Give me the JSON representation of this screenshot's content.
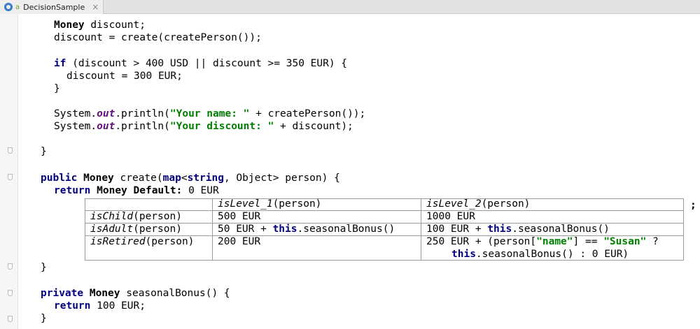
{
  "tab": {
    "title": "DecisionSample",
    "close": "×",
    "glyph": "a"
  },
  "code": {
    "l1_type": "Money",
    "l1_rest": " discount;",
    "l2": "discount = create(createPerson());",
    "l3_kw": "if",
    "l3_rest": " (discount > 400 USD || discount >= 350 EUR) {",
    "l4": "discount = 300 EUR;",
    "l5": "}",
    "l6_a": "System.",
    "l6_fld": "out",
    "l6_b": ".println(",
    "l6_str": "\"Your name: \"",
    "l6_c": " + createPerson());",
    "l7_a": "System.",
    "l7_fld": "out",
    "l7_b": ".println(",
    "l7_str": "\"Your discount: \"",
    "l7_c": " + discount);",
    "l8": "}",
    "l9_kw": "public",
    "l9_type": "Money",
    "l9_a": " create(",
    "l9_map": "map",
    "l9_b": "<",
    "l9_string": "string",
    "l9_c": ", Object> person) {",
    "l10_kw": "return",
    "l10_type": "Money Default:",
    "l10_rest": " 0 EUR",
    "semicolon": ";",
    "l11": "}",
    "l12_kw": "private",
    "l12_type": "Money",
    "l12_rest": " seasonalBonus() {",
    "l13_kw": "return",
    "l13_rest": " 100 EUR;",
    "l14": "}"
  },
  "table": {
    "col1_fn": "isLevel_1",
    "col1_arg": "(person)",
    "col2_fn": "isLevel_2",
    "col2_arg": "(person)",
    "rows": [
      {
        "cond_fn": "isChild",
        "cond_arg": "(person)",
        "c1": "500 EUR",
        "c2": "1000 EUR"
      },
      {
        "cond_fn": "isAdult",
        "cond_arg": "(person)",
        "c1_a": "50 EUR + ",
        "c1_kw": "this",
        "c1_b": ".seasonalBonus()",
        "c2_a": "100 EUR + ",
        "c2_kw": "this",
        "c2_b": ".seasonalBonus()"
      },
      {
        "cond_fn": "isRetired",
        "cond_arg": "(person)",
        "c1": "200 EUR",
        "c2_a": "250 EUR + (person[",
        "c2_str1": "\"name\"",
        "c2_b": "] == ",
        "c2_str2": "\"Susan\"",
        "c2_c": " ?",
        "c2_kw": "this",
        "c2_d": ".seasonalBonus() : 0 EUR)"
      }
    ]
  }
}
